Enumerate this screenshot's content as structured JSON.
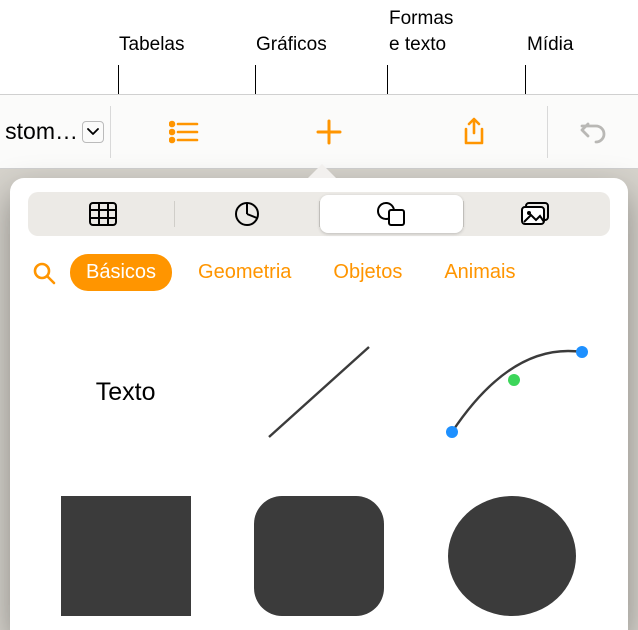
{
  "callouts": {
    "tables": "Tabelas",
    "charts": "Gráficos",
    "shapes_text_line1": "Formas",
    "shapes_text_line2": "e texto",
    "media": "Mídia"
  },
  "toolbar": {
    "doc_title": "stom…"
  },
  "segmented": {
    "tabs_icon": "tables-icon",
    "charts_icon": "chart-icon",
    "shapes_icon": "shapes-icon",
    "media_icon": "media-icon"
  },
  "categories": {
    "basic": "Básicos",
    "geometry": "Geometria",
    "objects": "Objetos",
    "animals": "Animais"
  },
  "shapes": {
    "text_label": "Texto"
  }
}
